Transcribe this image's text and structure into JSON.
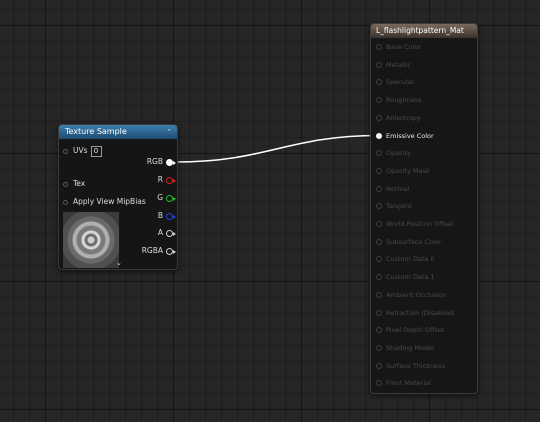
{
  "texture_node": {
    "title": "Texture Sample",
    "collapse_glyph": "⌃",
    "expand_glyph": "⌄",
    "inputs": [
      {
        "label": "UVs",
        "value": "0"
      },
      {
        "label": "Tex"
      },
      {
        "label": "Apply View MipBias"
      }
    ],
    "outputs": [
      {
        "label": "RGB",
        "color": "#ffffff"
      },
      {
        "label": "R",
        "color": "#e02020"
      },
      {
        "label": "G",
        "color": "#20c020"
      },
      {
        "label": "B",
        "color": "#2040e0"
      },
      {
        "label": "A",
        "color": "#d0d0d0"
      },
      {
        "label": "RGBA",
        "color": "#d0d0d0"
      }
    ]
  },
  "material_node": {
    "title": "L_flashlightpattern_Mat",
    "inputs": [
      {
        "label": "Base Color",
        "active": false
      },
      {
        "label": "Metallic",
        "active": false
      },
      {
        "label": "Specular",
        "active": false
      },
      {
        "label": "Roughness",
        "active": false
      },
      {
        "label": "Anisotropy",
        "active": false
      },
      {
        "label": "Emissive Color",
        "active": true
      },
      {
        "label": "Opacity",
        "active": false
      },
      {
        "label": "Opacity Mask",
        "active": false
      },
      {
        "label": "Normal",
        "active": false
      },
      {
        "label": "Tangent",
        "active": false
      },
      {
        "label": "World Position Offset",
        "active": false
      },
      {
        "label": "Subsurface Color",
        "active": false
      },
      {
        "label": "Custom Data 0",
        "active": false
      },
      {
        "label": "Custom Data 1",
        "active": false
      },
      {
        "label": "Ambient Occlusion",
        "active": false
      },
      {
        "label": "Refraction (Disabled)",
        "active": false
      },
      {
        "label": "Pixel Depth Offset",
        "active": false
      },
      {
        "label": "Shading Model",
        "active": false
      },
      {
        "label": "Surface Thickness",
        "active": false
      },
      {
        "label": "Front Material",
        "active": false
      }
    ]
  },
  "wire_color": "#ffffff"
}
